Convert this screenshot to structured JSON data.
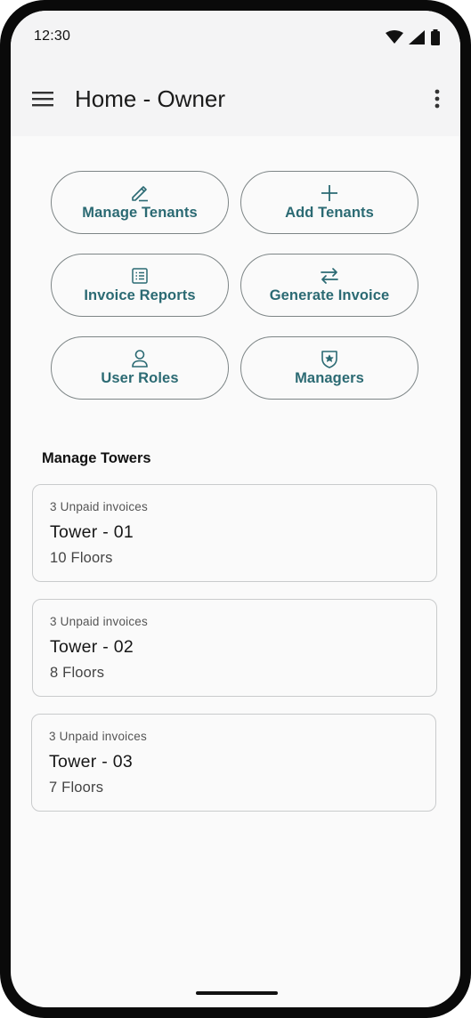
{
  "status_bar": {
    "time": "12:30"
  },
  "app_bar": {
    "title": "Home - Owner"
  },
  "actions": [
    {
      "label": "Manage Tenants",
      "icon": "edit-icon"
    },
    {
      "label": "Add Tenants",
      "icon": "add-icon"
    },
    {
      "label": "Invoice Reports",
      "icon": "list-icon"
    },
    {
      "label": "Generate Invoice",
      "icon": "swap-icon"
    },
    {
      "label": "User Roles",
      "icon": "person-icon"
    },
    {
      "label": "Managers",
      "icon": "shield-star-icon"
    }
  ],
  "section": {
    "title": "Manage Towers"
  },
  "towers": [
    {
      "unpaid": "3 Unpaid invoices",
      "name": "Tower - 01",
      "floors": "10 Floors"
    },
    {
      "unpaid": "3 Unpaid invoices",
      "name": "Tower - 02",
      "floors": "8 Floors"
    },
    {
      "unpaid": "3 Unpaid invoices",
      "name": "Tower - 03",
      "floors": "7 Floors"
    }
  ],
  "colors": {
    "accent": "#2b6a73",
    "outline": "#7d8586",
    "card_border": "#c9cbcc",
    "app_bar_bg": "#f4f4f5"
  }
}
